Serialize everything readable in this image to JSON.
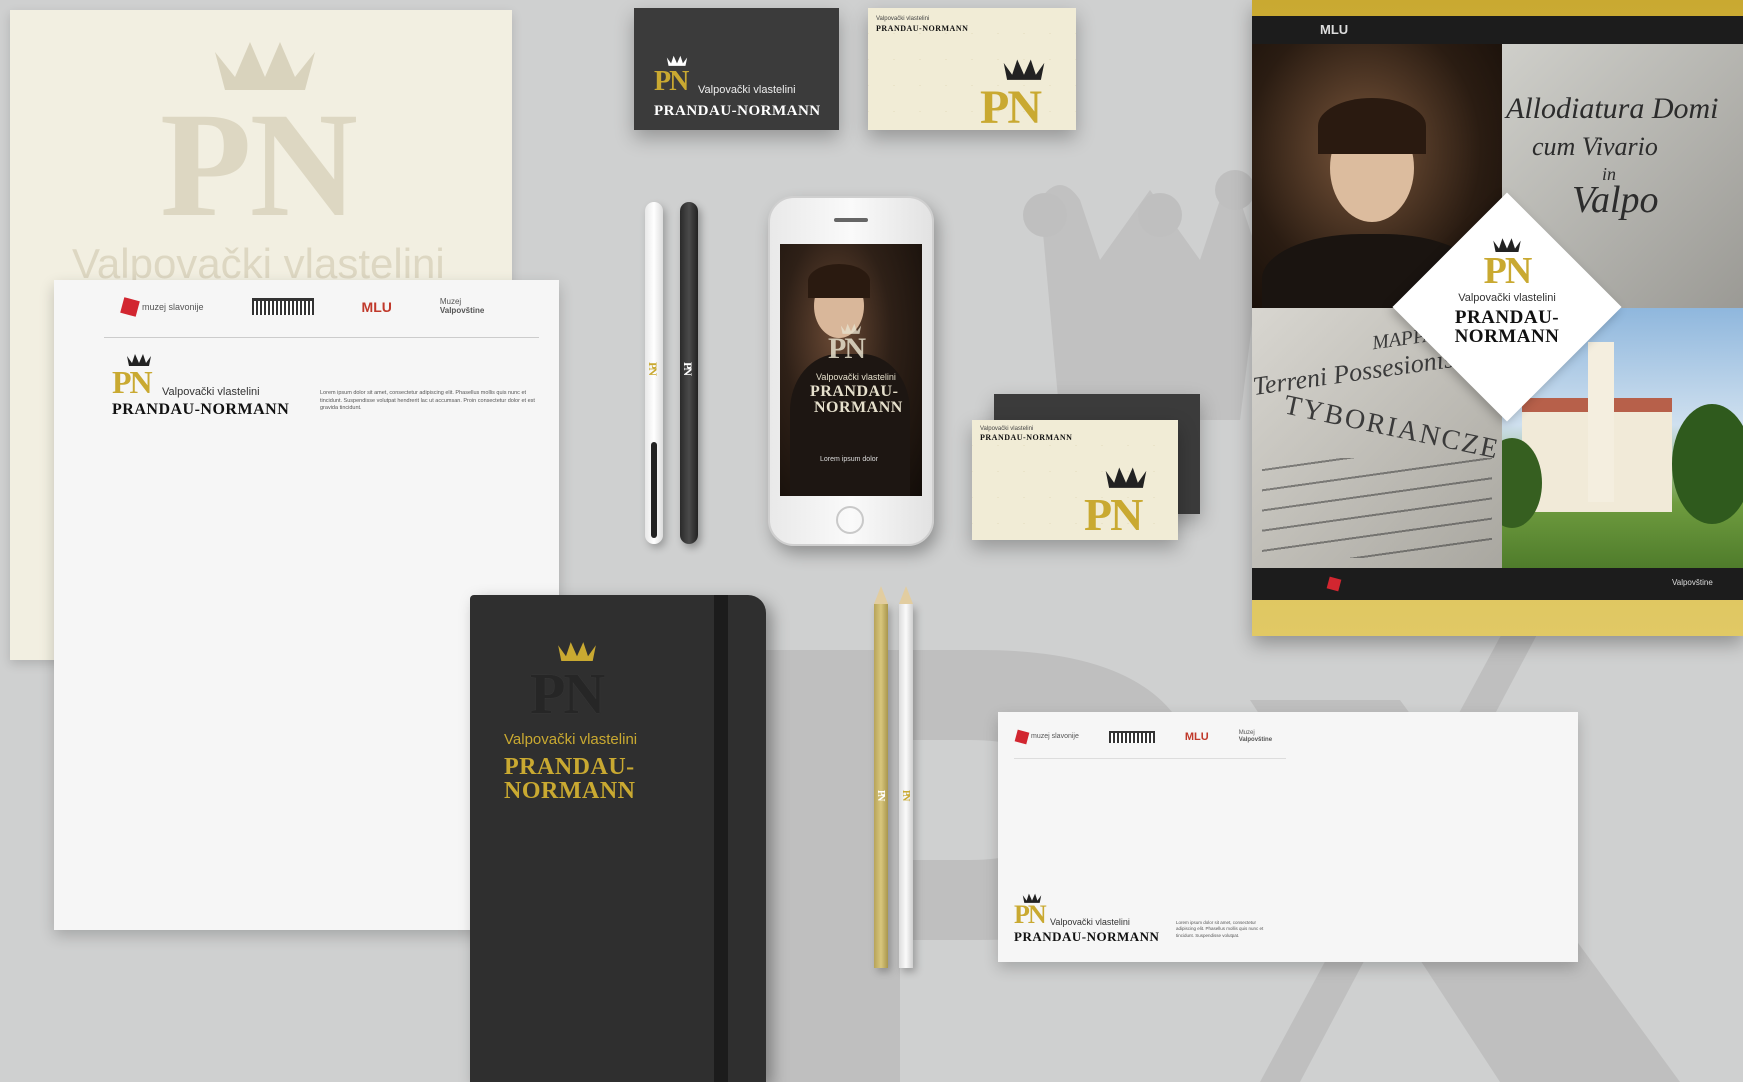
{
  "brand": {
    "monogram": "PN",
    "subtitle": "Valpovački vlastelini",
    "name": "PRANDAU-NORMANN",
    "name_line1": "PRANDAU-",
    "name_line2": "NORMANN"
  },
  "partners": {
    "muzej_slavonije": "muzej slavonije",
    "mlu": "MLU",
    "muzej_valpovstine_1": "Muzej",
    "muzej_valpovstine_2": "Valpovštine"
  },
  "letterhead": {
    "body": "Lorem ipsum dolor sit amet, consectetur adipiscing elit. Phasellus mollis quis nunc et tincidunt. Suspendisse volutpat hendrerit lac ut accumsan. Proin consectetur dolor et est gravida tincidunt."
  },
  "phone": {
    "caption": "Lorem ipsum dolor"
  },
  "envelope": {
    "body": "Lorem ipsum dolor sit amet, consectetur adipiscing elit. Phasellus mollis quis nunc et tincidunt. Suspendisse volutpat."
  },
  "poster": {
    "script_lines": [
      "Allodiatura Domi",
      "cum Vivario",
      "in",
      "Valpo"
    ],
    "map_lines": [
      "MAPPA",
      "Terreni Possesionis",
      "TYBORIANCZE"
    ]
  },
  "colors": {
    "gold": "#c9a931",
    "dark": "#3a3a3a",
    "cream": "#f1ecd6",
    "background": "#cfd0d0",
    "red": "#d22630"
  }
}
